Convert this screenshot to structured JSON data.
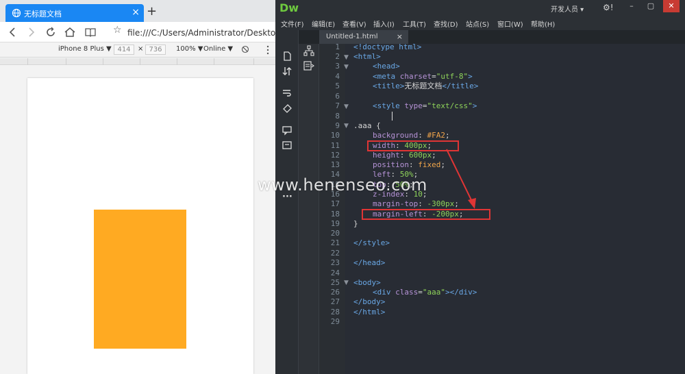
{
  "browser": {
    "tab_title": "无标题文档",
    "url": "file:///C:/Users/Administrator/Desktop/新",
    "device": "iPhone 8 Plus ▼",
    "width": "414",
    "times": "×",
    "height": "736",
    "zoom": "100% ▼",
    "network": "Online ▼",
    "new_tab": "+",
    "close_tab": "×"
  },
  "dw": {
    "logo": "Dw",
    "workspace": "开发人员 ▾",
    "menu": [
      "文件(F)",
      "编辑(E)",
      "查看(V)",
      "插入(I)",
      "工具(T)",
      "查找(D)",
      "站点(S)",
      "窗口(W)",
      "帮助(H)"
    ],
    "file_tab": "Untitled-1.html",
    "file_tab_close": "×",
    "more": "···"
  },
  "code": {
    "line_numbers": [
      "1",
      "2",
      "3",
      "4",
      "5",
      "6",
      "7",
      "8",
      "9",
      "10",
      "11",
      "12",
      "13",
      "14",
      "15",
      "16",
      "17",
      "18",
      "19",
      "20",
      "21",
      "22",
      "23",
      "24",
      "25",
      "26",
      "27",
      "28",
      "29"
    ],
    "l1": "<!doctype html>",
    "l2": "<html>",
    "l3": "<head>",
    "l4_tag": "<meta ",
    "l4_attr": "charset",
    "l4_eq": "=",
    "l4_str": "\"utf-8\"",
    "l4_end": ">",
    "l5_open": "<title>",
    "l5_text": "无标题文档",
    "l5_close": "</title>",
    "l7_tag": "<style ",
    "l7_attr": "type",
    "l7_eq": "=",
    "l7_str": "\"text/css\"",
    "l7_end": ">",
    "l9": ".aaa {",
    "l10_prop": "background",
    "l10_val": "#FA2",
    "l11_prop": "width",
    "l11_val": "400px",
    "l12_prop": "height",
    "l12_val": "600px",
    "l13_prop": "position",
    "l13_val": "fixed",
    "l14_prop": "left",
    "l14_val": "50%",
    "l15_prop": "top",
    "l15_val": "50%",
    "l16_prop": "z-index",
    "l16_val": "10",
    "l17_prop": "margin-top",
    "l17_val": "-300px",
    "l18_prop": "margin-left",
    "l18_val": "-200px",
    "colon": ": ",
    "semi": ";",
    "l19": "}",
    "l21": "</style>",
    "l23": "</head>",
    "l25": "<body>",
    "l26_tag": "<div ",
    "l26_attr": "class",
    "l26_eq": "=",
    "l26_str": "\"aaa\"",
    "l26_end": "></div>",
    "l27": "</body>",
    "l28": "</html>"
  },
  "watermark": "www.henenseo.com",
  "colors": {
    "box": "#ffaa22",
    "tab_active": "#1a87f3",
    "highlight": "#e03535",
    "dw_logo": "#6ec93f"
  }
}
